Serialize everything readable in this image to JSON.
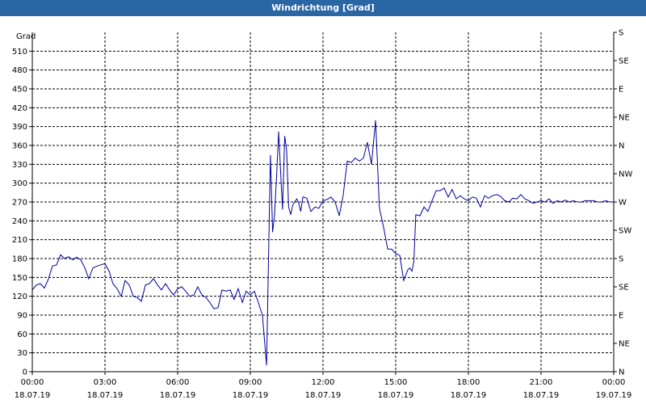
{
  "window": {
    "title": "Windrichtung [Grad]"
  },
  "chart_data": {
    "type": "line",
    "title": "Windrichtung [Grad]",
    "ylabel": "Grad",
    "ylim": [
      0,
      540
    ],
    "y_ticks": [
      0,
      30,
      60,
      90,
      120,
      150,
      180,
      210,
      240,
      270,
      300,
      330,
      360,
      390,
      420,
      450,
      480,
      510
    ],
    "right_axis_labels": [
      "N",
      "NE",
      "E",
      "SE",
      "S",
      "SW",
      "W",
      "NW",
      "N",
      "NE",
      "E",
      "SE",
      "S"
    ],
    "x_ticks": [
      {
        "time": "00:00",
        "date": "18.07.19",
        "hour": 0
      },
      {
        "time": "03:00",
        "date": "18.07.19",
        "hour": 3
      },
      {
        "time": "06:00",
        "date": "18.07.19",
        "hour": 6
      },
      {
        "time": "09:00",
        "date": "18.07.19",
        "hour": 9
      },
      {
        "time": "12:00",
        "date": "18.07.19",
        "hour": 12
      },
      {
        "time": "15:00",
        "date": "18.07.19",
        "hour": 15
      },
      {
        "time": "18:00",
        "date": "18.07.19",
        "hour": 18
      },
      {
        "time": "21:00",
        "date": "18.07.19",
        "hour": 21
      },
      {
        "time": "00:00",
        "date": "19.07.19",
        "hour": 24
      }
    ],
    "xlim_hours": [
      0,
      24
    ],
    "grid": true,
    "line_color": "#0000a0",
    "series": [
      {
        "x_hours": [
          0.0,
          0.17,
          0.33,
          0.5,
          0.67,
          0.83,
          1.0,
          1.17,
          1.33,
          1.5,
          1.67,
          1.83,
          2.0,
          2.17,
          2.33,
          2.5,
          2.67,
          2.83,
          3.0,
          3.17,
          3.33,
          3.5,
          3.67,
          3.83,
          4.0,
          4.17,
          4.33,
          4.5,
          4.67,
          4.83,
          5.0,
          5.17,
          5.33,
          5.5,
          5.67,
          5.83,
          6.0,
          6.17,
          6.33,
          6.5,
          6.67,
          6.83,
          7.0,
          7.17,
          7.33,
          7.5,
          7.67,
          7.83,
          8.0,
          8.17,
          8.33,
          8.5,
          8.67,
          8.83,
          9.0,
          9.17,
          9.33,
          9.5,
          9.67,
          9.83,
          9.92,
          10.0,
          10.08,
          10.17,
          10.25,
          10.33,
          10.42,
          10.5,
          10.58,
          10.67,
          10.75,
          10.83,
          10.92,
          11.0,
          11.08,
          11.17,
          11.33,
          11.5,
          11.67,
          11.83,
          12.0,
          12.17,
          12.33,
          12.5,
          12.67,
          12.83,
          13.0,
          13.17,
          13.33,
          13.5,
          13.67,
          13.83,
          14.0,
          14.17,
          14.33,
          14.5,
          14.67,
          14.83,
          15.0,
          15.17,
          15.33,
          15.5,
          15.58,
          15.67,
          15.75,
          15.83,
          16.0,
          16.17,
          16.33,
          16.5,
          16.67,
          16.83,
          17.0,
          17.17,
          17.33,
          17.5,
          17.67,
          17.83,
          18.0,
          18.17,
          18.33,
          18.5,
          18.67,
          18.83,
          19.0,
          19.17,
          19.33,
          19.5,
          19.67,
          19.83,
          20.0,
          20.17,
          20.33,
          20.5,
          20.67,
          20.83,
          21.0,
          21.17,
          21.33,
          21.5,
          21.67,
          21.83,
          22.0,
          22.17,
          22.33,
          22.5,
          22.67,
          22.83,
          23.0,
          23.17,
          23.33,
          23.5,
          23.67,
          23.83,
          24.0
        ],
        "values": [
          130,
          138,
          140,
          133,
          148,
          168,
          170,
          186,
          180,
          183,
          178,
          182,
          178,
          165,
          148,
          165,
          168,
          170,
          172,
          160,
          140,
          132,
          120,
          145,
          138,
          120,
          118,
          112,
          138,
          140,
          148,
          138,
          130,
          140,
          130,
          122,
          132,
          135,
          128,
          120,
          122,
          135,
          122,
          118,
          110,
          100,
          102,
          130,
          128,
          130,
          115,
          132,
          110,
          128,
          122,
          128,
          110,
          90,
          10,
          345,
          222,
          250,
          308,
          382,
          318,
          258,
          375,
          352,
          262,
          250,
          265,
          270,
          275,
          268,
          255,
          278,
          276,
          255,
          262,
          260,
          272,
          274,
          278,
          270,
          248,
          280,
          335,
          333,
          340,
          335,
          340,
          365,
          330,
          400,
          260,
          230,
          195,
          195,
          188,
          185,
          145,
          162,
          165,
          160,
          175,
          250,
          248,
          262,
          255,
          272,
          288,
          288,
          292,
          278,
          290,
          275,
          280,
          275,
          272,
          278,
          276,
          262,
          280,
          276,
          280,
          282,
          279,
          272,
          270,
          276,
          275,
          282,
          275,
          272,
          268,
          270,
          272,
          270,
          275,
          268,
          272,
          270,
          273,
          270,
          272,
          270,
          270,
          272,
          272,
          272,
          270,
          270,
          272,
          270,
          270,
          270,
          270,
          270,
          268
        ]
      }
    ]
  }
}
